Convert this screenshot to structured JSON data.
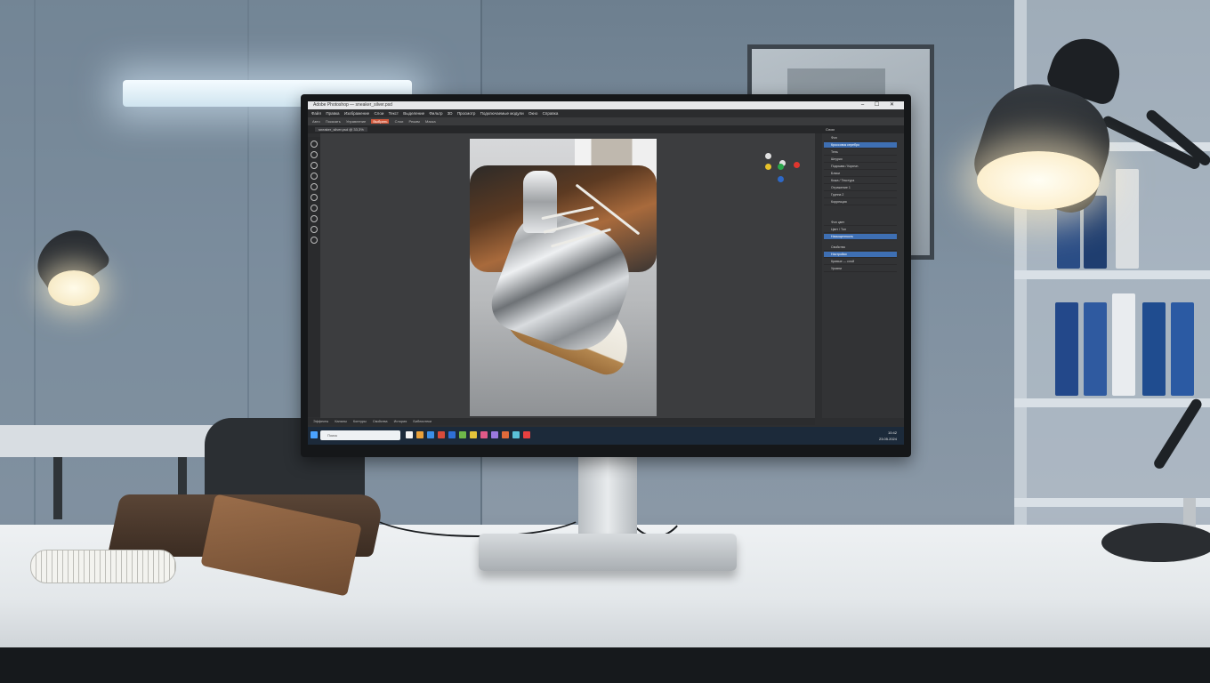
{
  "app": {
    "window_title": "Adobe Photoshop — sneaker_silver.psd",
    "menu": [
      "Файл",
      "Правка",
      "Изображение",
      "Слои",
      "Текст",
      "Выделение",
      "Фильтр",
      "3D",
      "Просмотр",
      "Подключаемые модули",
      "Окно",
      "Справка"
    ],
    "options": [
      "Авто",
      "Показать",
      "Управление",
      "Слои",
      "Режим",
      "Маска"
    ],
    "options_highlight": "Выбрать",
    "doc_tab": "sneaker_silver.psd @ 33,3%",
    "panel_title": "Слои",
    "layers": [
      {
        "label": "Фон",
        "selected": false
      },
      {
        "label": "Кроссовок серебро",
        "selected": true
      },
      {
        "label": "Тень",
        "selected": false
      },
      {
        "label": "Шнурки",
        "selected": false
      },
      {
        "label": "Подошва / Коричн.",
        "selected": false
      },
      {
        "label": "Блики",
        "selected": false
      },
      {
        "label": "Кожа / Текстура",
        "selected": false
      },
      {
        "label": "Отражение 1",
        "selected": false
      },
      {
        "label": "Группа 2",
        "selected": false
      },
      {
        "label": "Коррекция",
        "selected": false
      }
    ],
    "layers2": [
      {
        "label": "Фон цвет",
        "selected": false
      },
      {
        "label": "Цвет / Тон",
        "selected": false
      },
      {
        "label": "Насыщенность",
        "selected": true
      }
    ],
    "layers3": [
      {
        "label": "Свойства",
        "selected": false
      },
      {
        "label": "Настройки",
        "selected": true
      },
      {
        "label": "Кривые — слой",
        "selected": false
      },
      {
        "label": "Уровни",
        "selected": false
      }
    ],
    "status": [
      "Эффекты",
      "Каналы",
      "Контуры",
      "Свойства",
      "История",
      "Библиотеки"
    ],
    "taskbar_search": "Поиск",
    "tray_time": "10:42",
    "tray_date": "23.05.2024"
  },
  "colors": {
    "accent": "#3e6fb3",
    "taskbar": "#1c2a3a",
    "ui_dark": "#2d2e30"
  },
  "icons": [
    "search-icon",
    "brush-icon",
    "move-icon",
    "lasso-icon",
    "crop-icon",
    "eyedropper-icon",
    "eraser-icon",
    "text-icon",
    "hand-icon",
    "zoom-icon",
    "windows-icon"
  ]
}
